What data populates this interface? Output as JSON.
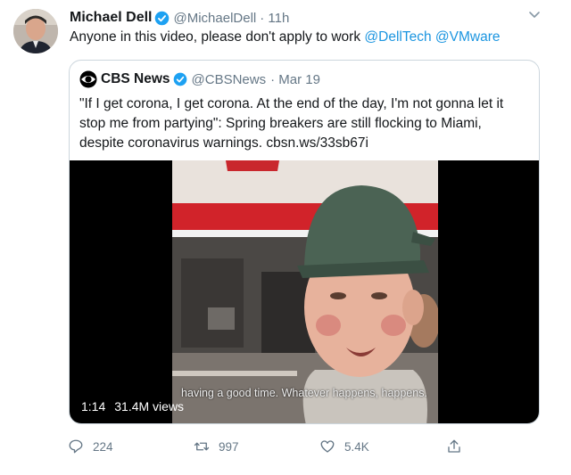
{
  "author": {
    "name": "Michael Dell",
    "handle": "@MichaelDell",
    "time": "· 11h"
  },
  "tweet": {
    "text_prefix": "Anyone in this video, please don't apply to work ",
    "mention_1": "@DellTech",
    "mention_2": "@VMware"
  },
  "quoted": {
    "name": "CBS News",
    "handle": "@CBSNews",
    "date": "· Mar 19",
    "text": "\"If I get corona, I get corona. At the end of the day, I'm not gonna let it stop me from partying\": Spring breakers are still flocking to Miami, despite coronavirus warnings. cbsn.ws/33sb67i",
    "video": {
      "caption": "having a good time. Whatever happens, happens.",
      "duration": "1:14",
      "views": "31.4M views"
    }
  },
  "actions": {
    "replies": "224",
    "retweets": "997",
    "likes": "5.4K"
  },
  "colors": {
    "link": "#1b95e0",
    "verified": "#1da1f2",
    "muted": "#657786"
  }
}
